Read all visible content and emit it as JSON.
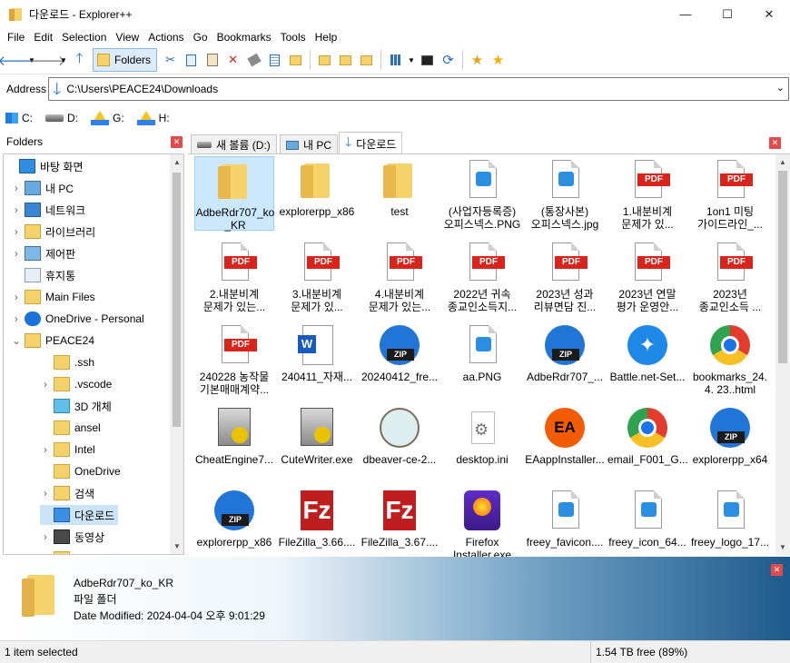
{
  "window": {
    "title": "다운로드 - Explorer++",
    "controls": [
      "—",
      "☐",
      "✕"
    ]
  },
  "menu": [
    "File",
    "Edit",
    "Selection",
    "View",
    "Actions",
    "Go",
    "Bookmarks",
    "Tools",
    "Help"
  ],
  "toolbar": {
    "folders_label": "Folders"
  },
  "address": {
    "label": "Address",
    "path": "C:\\Users\\PEACE24\\Downloads"
  },
  "drives": [
    {
      "letter": "C:",
      "icon": "windows-drive-icon"
    },
    {
      "letter": "D:",
      "icon": "hard-drive-icon"
    },
    {
      "letter": "G:",
      "icon": "google-drive-icon"
    },
    {
      "letter": "H:",
      "icon": "google-drive-icon"
    }
  ],
  "folders_pane": {
    "title": "Folders"
  },
  "tree": [
    {
      "label": "바탕 화면",
      "indent": 0,
      "expander": "",
      "icon": "desktop-icon"
    },
    {
      "label": "내 PC",
      "indent": 1,
      "expander": ">",
      "icon": "pc-icon"
    },
    {
      "label": "네트워크",
      "indent": 1,
      "expander": ">",
      "icon": "network-icon"
    },
    {
      "label": "라이브러리",
      "indent": 1,
      "expander": ">",
      "icon": "library-icon"
    },
    {
      "label": "제어판",
      "indent": 1,
      "expander": ">",
      "icon": "control-panel-icon"
    },
    {
      "label": "휴지통",
      "indent": 1,
      "expander": "",
      "icon": "recycle-bin-icon"
    },
    {
      "label": "Main Files",
      "indent": 1,
      "expander": ">",
      "icon": "folder-icon"
    },
    {
      "label": "OneDrive - Personal",
      "indent": 1,
      "expander": ">",
      "icon": "onedrive-icon"
    },
    {
      "label": "PEACE24",
      "indent": 1,
      "expander": "v",
      "icon": "user-folder-icon"
    },
    {
      "label": ".ssh",
      "indent": 2,
      "expander": "",
      "icon": "folder-icon"
    },
    {
      "label": ".vscode",
      "indent": 2,
      "expander": ">",
      "icon": "folder-icon"
    },
    {
      "label": "3D 개체",
      "indent": 2,
      "expander": "",
      "icon": "3d-objects-icon"
    },
    {
      "label": "ansel",
      "indent": 2,
      "expander": "",
      "icon": "folder-icon"
    },
    {
      "label": "Intel",
      "indent": 2,
      "expander": ">",
      "icon": "folder-icon"
    },
    {
      "label": "OneDrive",
      "indent": 2,
      "expander": "",
      "icon": "folder-icon"
    },
    {
      "label": "검색",
      "indent": 2,
      "expander": ">",
      "icon": "search-folder-icon"
    },
    {
      "label": "다운로드",
      "indent": 2,
      "expander": "",
      "icon": "downloads-icon",
      "selected": true
    },
    {
      "label": "동영상",
      "indent": 2,
      "expander": ">",
      "icon": "videos-icon"
    },
    {
      "label": "링크",
      "indent": 2,
      "expander": "",
      "icon": "folder-icon"
    }
  ],
  "tabs": [
    {
      "label": "새 볼륨 (D:)",
      "icon": "hard-drive-icon",
      "active": false
    },
    {
      "label": "내 PC",
      "icon": "pc-icon",
      "active": false
    },
    {
      "label": "다운로드",
      "icon": "downloads-icon",
      "active": true
    }
  ],
  "files": [
    {
      "name": "AdbeRdr707_ko\n_KR",
      "type": "folder",
      "selected": true
    },
    {
      "name": "explorerpp_x86",
      "type": "folder"
    },
    {
      "name": "test",
      "type": "folder"
    },
    {
      "name": "(사업자등록증)\n오피스넥스.PNG",
      "type": "image"
    },
    {
      "name": "(통장사본)\n오피스넥스.jpg",
      "type": "image"
    },
    {
      "name": "1.내분비계\n문제가 있...",
      "type": "pdf"
    },
    {
      "name": "1on1 미팅\n가이드라인_...",
      "type": "pdf"
    },
    {
      "name": "2.내분비계\n문제가 있는...",
      "type": "pdf"
    },
    {
      "name": "3.내분비계\n문제가 있...",
      "type": "pdf"
    },
    {
      "name": "4.내분비계\n문제가 있는...",
      "type": "pdf"
    },
    {
      "name": "2022년 귀속\n종교인소득지...",
      "type": "pdf"
    },
    {
      "name": "2023년 성과\n리뷰면담 진...",
      "type": "pdf"
    },
    {
      "name": "2023년 연말\n평가 운영안...",
      "type": "pdf"
    },
    {
      "name": "2023년\n종교인소득 ...",
      "type": "pdf"
    },
    {
      "name": "240228 농작물\n기본매매계약...",
      "type": "pdf"
    },
    {
      "name": "240411_자재...",
      "type": "word"
    },
    {
      "name": "20240412_fre...",
      "type": "zip"
    },
    {
      "name": "aa.PNG",
      "type": "image"
    },
    {
      "name": "AdbeRdr707_...",
      "type": "zip"
    },
    {
      "name": "Battle.net-Set...",
      "type": "battlenet"
    },
    {
      "name": "bookmarks_24.\n4. 23..html",
      "type": "chrome"
    },
    {
      "name": "CheatEngine7...",
      "type": "setup"
    },
    {
      "name": "CuteWriter.exe",
      "type": "setup"
    },
    {
      "name": "dbeaver-ce-2...",
      "type": "dbeaver"
    },
    {
      "name": "desktop.ini",
      "type": "ini"
    },
    {
      "name": "EAappInstaller...",
      "type": "ea"
    },
    {
      "name": "email_F001_G...",
      "type": "chrome"
    },
    {
      "name": "explorerpp_x64",
      "type": "zip"
    },
    {
      "name": "explorerpp_x86",
      "type": "zip"
    },
    {
      "name": "FileZilla_3.66....",
      "type": "filezilla"
    },
    {
      "name": "FileZilla_3.67....",
      "type": "filezilla"
    },
    {
      "name": "Firefox\nInstaller.exe",
      "type": "firefox"
    },
    {
      "name": "freey_favicon....",
      "type": "image"
    },
    {
      "name": "freey_icon_64...",
      "type": "image"
    },
    {
      "name": "freey_logo_17...",
      "type": "image"
    }
  ],
  "details": {
    "name": "AdbeRdr707_ko_KR",
    "type": "파일 폴더",
    "date": "Date Modified: 2024-04-04 오후 9:01:29"
  },
  "status": {
    "selection": "1 item selected",
    "free": "1.54 TB free (89%)"
  },
  "colors": {
    "selection": "#cce8ff",
    "pdf": "#d9241c",
    "zip": "#2075d6",
    "folder": "#f6d36a"
  }
}
